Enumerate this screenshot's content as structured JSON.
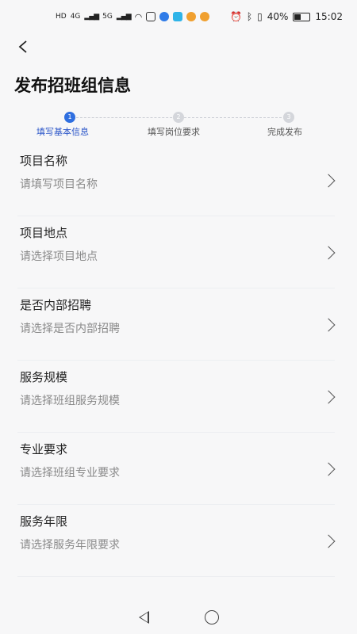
{
  "status_bar": {
    "net_type_1": "4G",
    "net_type_2": "5G",
    "battery_percent": "40%",
    "time": "15:02",
    "icons": [
      "hd-icon",
      "signal-icon",
      "wifi-icon",
      "bluetooth-icon",
      "vibrate-icon",
      "alarm-icon",
      "battery-icon"
    ]
  },
  "header": {
    "title": "发布招班组信息"
  },
  "stepper": {
    "steps": [
      {
        "number": "1",
        "label": "填写基本信息",
        "active": true
      },
      {
        "number": "2",
        "label": "填写岗位要求",
        "active": false
      },
      {
        "number": "3",
        "label": "完成发布",
        "active": false
      }
    ]
  },
  "form": {
    "rows": [
      {
        "label": "项目名称",
        "placeholder": "请填写项目名称"
      },
      {
        "label": "项目地点",
        "placeholder": "请选择项目地点"
      },
      {
        "label": "是否内部招聘",
        "placeholder": "请选择是否内部招聘"
      },
      {
        "label": "服务规模",
        "placeholder": "请选择班组服务规模"
      },
      {
        "label": "专业要求",
        "placeholder": "请选择班组专业要求"
      },
      {
        "label": "服务年限",
        "placeholder": "请选择服务年限要求"
      }
    ]
  },
  "colors": {
    "accent": "#2f6fe0",
    "background": "#f7f7f8",
    "placeholder": "#8a8a8a"
  }
}
